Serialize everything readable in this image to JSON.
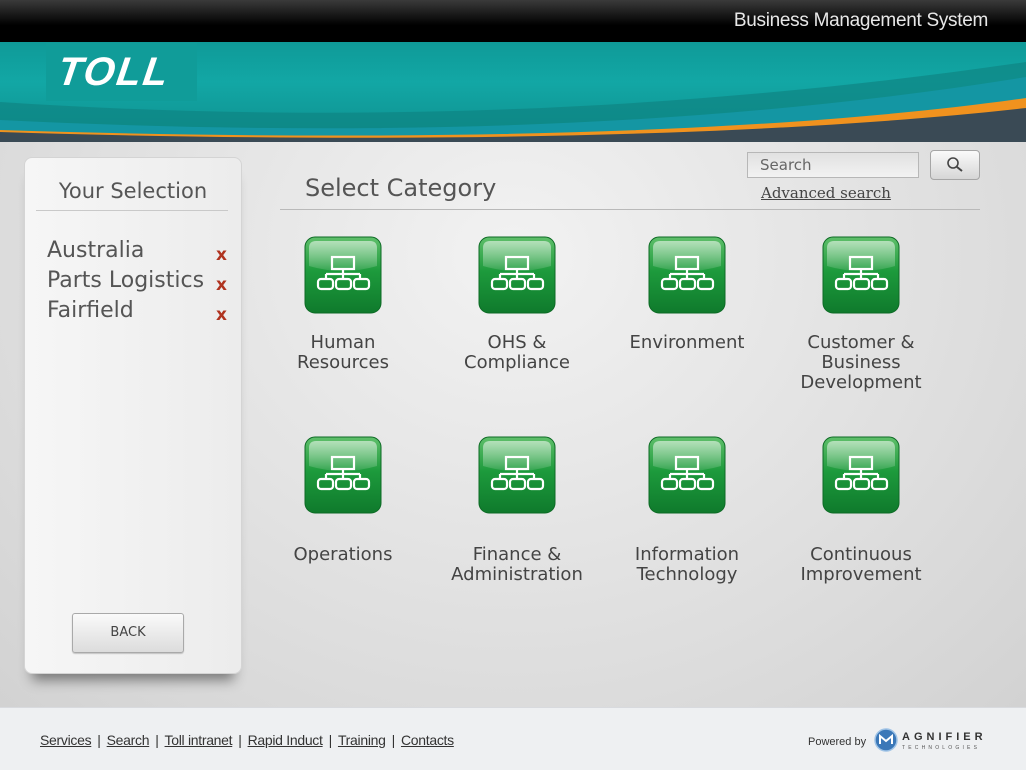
{
  "header": {
    "title": "Business Management System",
    "logo_text": "TOLL"
  },
  "sidebar": {
    "title": "Your Selection",
    "items": [
      {
        "label": "Australia"
      },
      {
        "label": "Parts Logistics"
      },
      {
        "label": "Fairfield"
      }
    ],
    "remove_glyph": "x",
    "back_label": "BACK"
  },
  "main": {
    "heading": "Select Category",
    "search": {
      "placeholder": "Search",
      "advanced_label": "Advanced search"
    },
    "categories": [
      {
        "label": "Human\nResources",
        "icon": "org-chart-icon"
      },
      {
        "label": "OHS &\nCompliance",
        "icon": "org-chart-icon"
      },
      {
        "label": "Environment",
        "icon": "org-chart-icon"
      },
      {
        "label": "Customer &\nBusiness\nDevelopment",
        "icon": "org-chart-icon"
      },
      {
        "label": "Operations",
        "icon": "org-chart-icon"
      },
      {
        "label": "Finance &\nAdministration",
        "icon": "org-chart-icon"
      },
      {
        "label": "Information\nTechnology",
        "icon": "org-chart-icon"
      },
      {
        "label": "Continuous\nImprovement",
        "icon": "org-chart-icon"
      }
    ]
  },
  "footer": {
    "links": [
      "Services",
      "Search",
      "Toll intranet",
      "Rapid Induct",
      "Training",
      "Contacts"
    ],
    "separator": "|",
    "powered_by": "Powered by",
    "vendor_name": "AGNIFIER",
    "vendor_sub": "TECHNOLOGIES"
  },
  "colors": {
    "teal": "#12a7a5",
    "orange": "#f0921e",
    "icon_green": "#1a8f3a",
    "remove_red": "#b0331f"
  }
}
